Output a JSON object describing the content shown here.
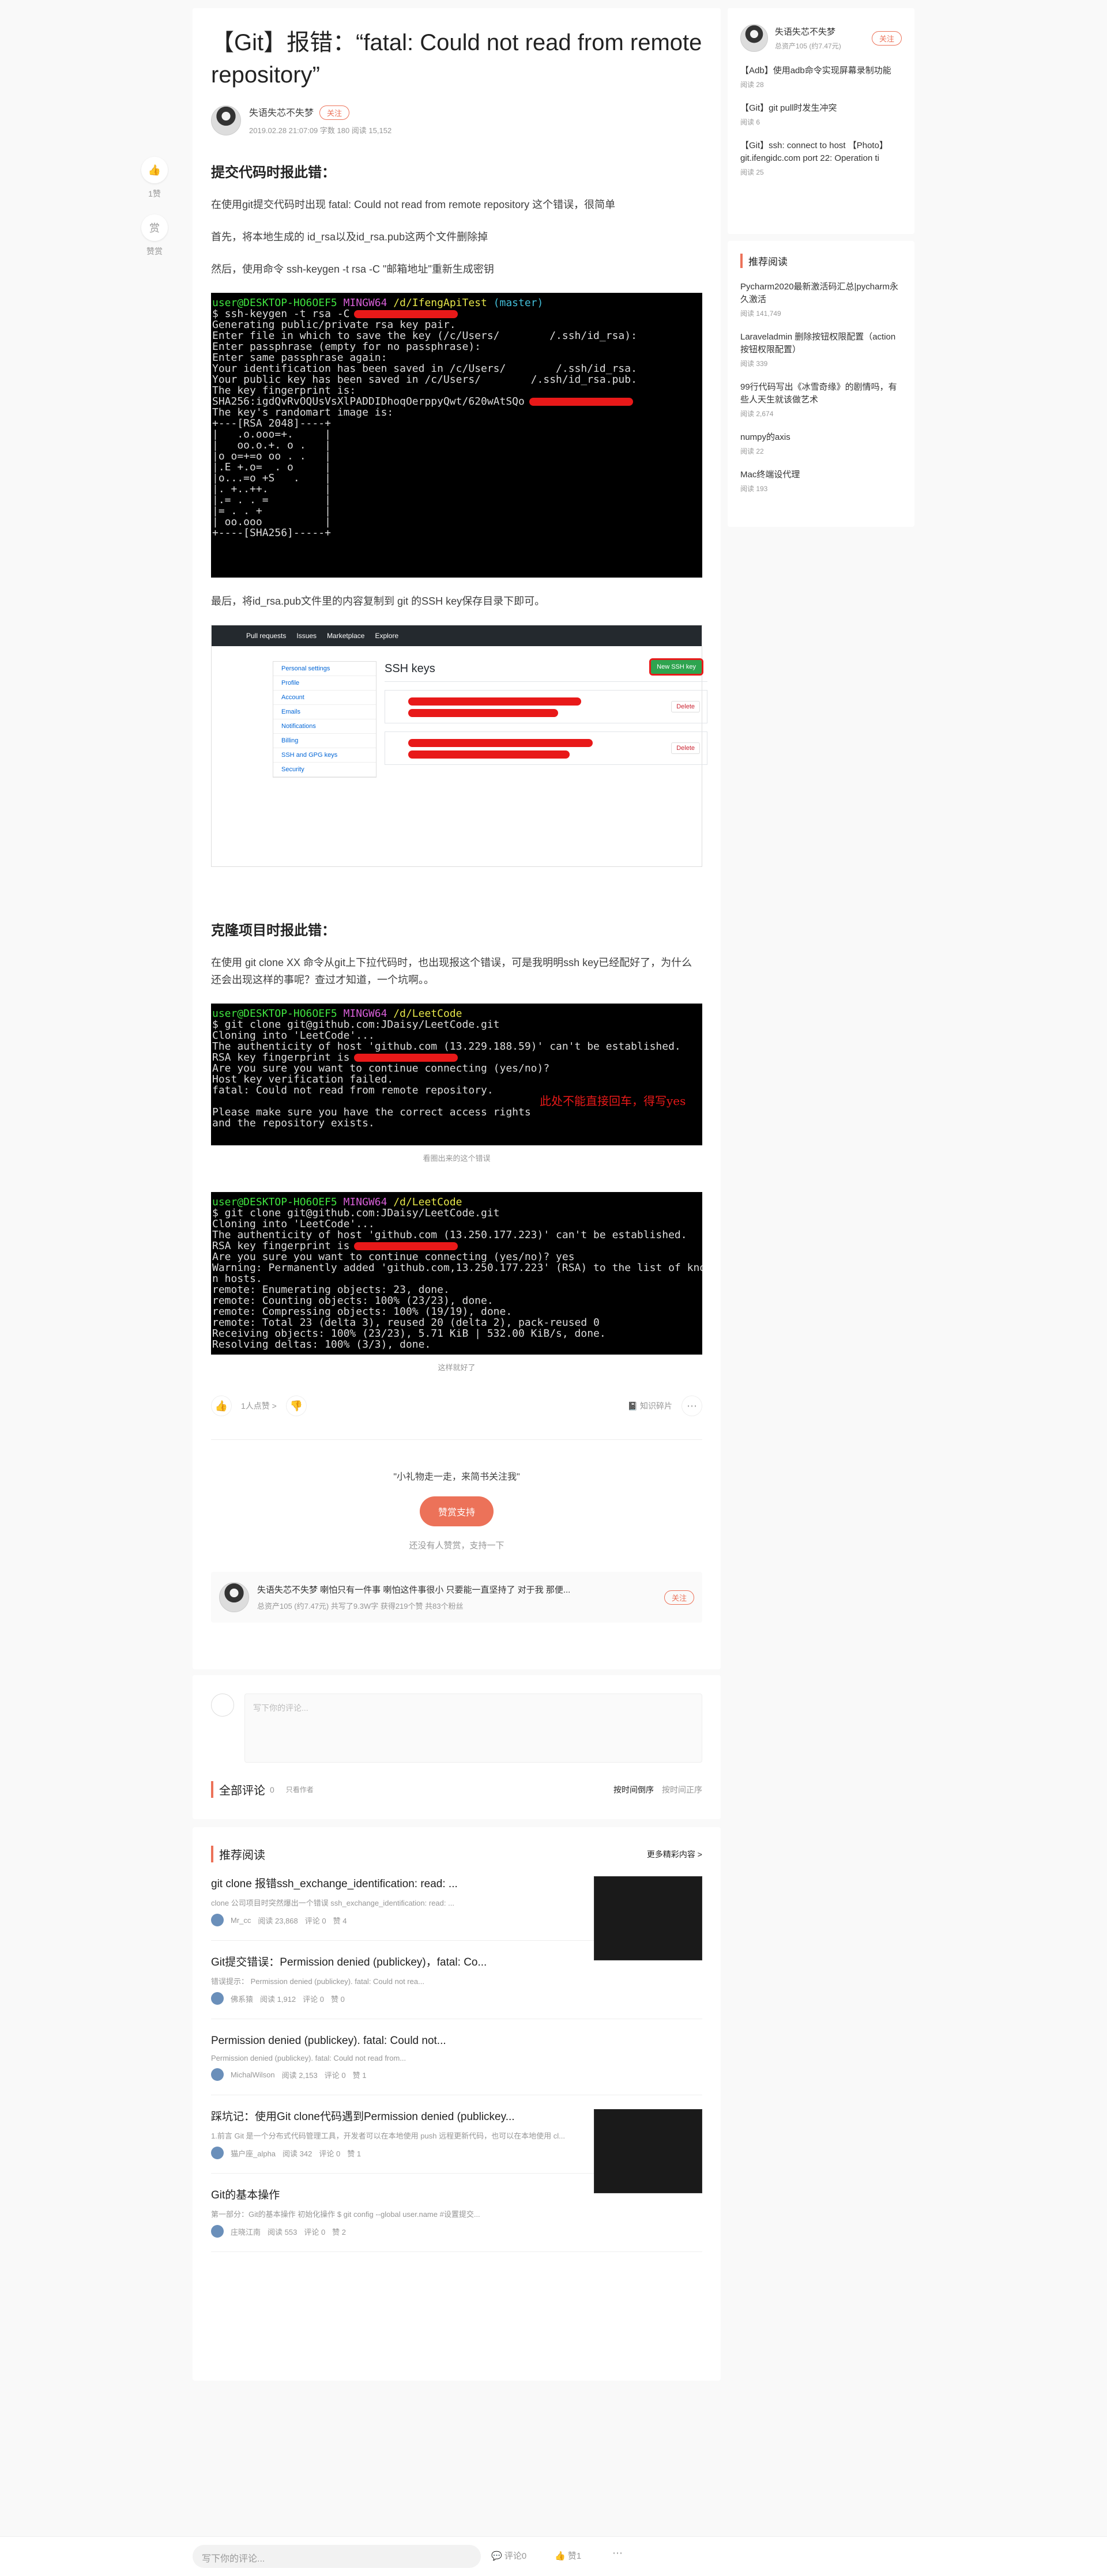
{
  "article": {
    "title": "【Git】报错：“fatal: Could not read from remote repository”",
    "author": "失语失芯不失梦",
    "follow": "关注",
    "meta": "2019.02.28 21:07:09   字数 180   阅读 15,152",
    "s1_heading": "提交代码时报此错：",
    "p1": "在使用git提交代码时出现 fatal: Could not read from remote repository 这个错误，很简单",
    "p2": "首先，将本地生成的 id_rsa以及id_rsa.pub这两个文件删除掉",
    "p3": "然后，使用命令 ssh-keygen -t rsa -C \"邮箱地址\"重新生成密钥",
    "p4": "最后，将id_rsa.pub文件里的内容复制到 git 的SSH key保存目录下即可。",
    "s2_heading": "克隆项目时报此错：",
    "p5": "在使用 git clone XX 命令从git上下拉代码时，也出现报这个错误，可是我明明ssh key已经配好了，为什么还会出现这样的事呢？查过才知道，一个坑啊。。",
    "caption1": "看圈出来的这个错误",
    "caption2": "这样就好了",
    "annotation": "此处不能直接回车，得写yes",
    "likes": "1人点赞 >",
    "collection": "知识碎片",
    "reward_note": "\"小礼物走一走，来简书关注我\"",
    "reward_button": "赞赏支持",
    "reward_empty": "还没有人赞赏，支持一下",
    "author_bio": "失语失芯不失梦  喇怕只有一件事 喇怕这件事很小 只要能一直坚持了 对于我 那便...",
    "author_stats": "总资产105 (约7.47元)   共写了9.3W字   获得219个赞   共83个粉丝"
  },
  "terminal1": [
    [
      "user@DESKTOP-HO6OEF5 ",
      "MINGW64 ",
      "/d/IfengApiTest ",
      "(master)"
    ],
    "$ ssh-keygen -t rsa -C",
    "Generating public/private rsa key pair.",
    "Enter file in which to save the key (/c/Users/        /.ssh/id_rsa):",
    "Enter passphrase (empty for no passphrase):",
    "Enter same passphrase again:",
    "Your identification has been saved in /c/Users/        /.ssh/id_rsa.",
    "Your public key has been saved in /c/Users/        /.ssh/id_rsa.pub.",
    "The key fingerprint is:",
    "SHA256:igdQvRvOQUsVsXlPADDIDhoqOerppyQwt/620wAtSQo",
    "The key's randomart image is:",
    "+---[RSA 2048]----+",
    "|   .o.ooo=+.     |",
    "|   oo.o.+. o .   |",
    "|o o=+=o oo . .   |",
    "|.E +.o=  . o     |",
    "|o...=o +S   .    |",
    "|. +..++.         |",
    "|.= . . =         |",
    "|= . . +          |",
    "| oo.ooo          |",
    "+----[SHA256]-----+"
  ],
  "terminal2": [
    [
      "user@DESKTOP-HO6OEF5 ",
      "MINGW64 ",
      "/d/LeetCode",
      ""
    ],
    "$ git clone git@github.com:JDaisy/LeetCode.git",
    "Cloning into 'LeetCode'...",
    "The authenticity of host 'github.com (13.229.188.59)' can't be established.",
    "RSA key fingerprint is",
    "Are you sure you want to continue connecting (yes/no)?",
    "Host key verification failed.",
    "fatal: Could not read from remote repository.",
    "",
    "Please make sure you have the correct access rights",
    "and the repository exists."
  ],
  "terminal3": [
    [
      "user@DESKTOP-HO6OEF5 ",
      "MINGW64 ",
      "/d/LeetCode",
      ""
    ],
    "$ git clone git@github.com:JDaisy/LeetCode.git",
    "Cloning into 'LeetCode'...",
    "The authenticity of host 'github.com (13.250.177.223)' can't be established.",
    "RSA key fingerprint is",
    "Are you sure you want to continue connecting (yes/no)? yes",
    "Warning: Permanently added 'github.com,13.250.177.223' (RSA) to the list of know",
    "n hosts.",
    "remote: Enumerating objects: 23, done.",
    "remote: Counting objects: 100% (23/23), done.",
    "remote: Compressing objects: 100% (19/19), done.",
    "remote: Total 23 (delta 3), reused 20 (delta 2), pack-reused 0",
    "Receiving objects: 100% (23/23), 5.71 KiB | 532.00 KiB/s, done.",
    "Resolving deltas: 100% (3/3), done."
  ],
  "github": {
    "nav": [
      "Pull requests",
      "Issues",
      "Marketplace",
      "Explore"
    ],
    "side": [
      "Personal settings",
      "Profile",
      "Account",
      "Emails",
      "Notifications",
      "Billing",
      "SSH and GPG keys",
      "Security"
    ],
    "title": "SSH keys",
    "new_key": "New SSH key",
    "delete": "Delete"
  },
  "left_actions": {
    "likes": "1赞",
    "reward_icon": "赏",
    "reward": "赞赏"
  },
  "comments": {
    "placeholder": "写下你的评论...",
    "all": "全部评论",
    "count": "0",
    "only_author": "只看作者",
    "sort_time": "按时间倒序",
    "sort_asc": "按时间正序"
  },
  "recommend": {
    "title": "推荐阅读",
    "more": "更多精彩内容 >",
    "items": [
      {
        "title": "git clone 报错ssh_exchange_identification: read: ...",
        "desc": "clone 公司项目时突然爆出一个错误 ssh_exchange_identification: read: ...",
        "author": "Mr_cc",
        "reads": "阅读 23,868",
        "comments": "评论 0",
        "likes": "赞 4",
        "thumb": true
      },
      {
        "title": "Git提交错误：Permission denied (publickey)，fatal: Co...",
        "desc": "错误提示：  Permission denied (publickey). fatal: Could not rea...",
        "author": "佛系猿",
        "reads": "阅读 1,912",
        "comments": "评论 0",
        "likes": "赞 0",
        "thumb": false
      },
      {
        "title": "Permission denied (publickey). fatal: Could not...",
        "desc": "Permission denied (publickey). fatal: Could not read from...",
        "author": "MichalWilson",
        "reads": "阅读 2,153",
        "comments": "评论 0",
        "likes": "赞 1",
        "thumb": false
      },
      {
        "title": "踩坑记：使用Git clone代码遇到Permission denied (publickey...",
        "desc": "1.前言 Git 是一个分布式代码管理工具，开发者可以在本地使用 push 远程更新代码，也可以在本地使用 cl...",
        "author": "猫户座_alpha",
        "reads": "阅读 342",
        "comments": "评论 0",
        "likes": "赞 1",
        "thumb": true
      },
      {
        "title": "Git的基本操作",
        "desc": "第一部分：Git的基本操作 初始化操作 $ git config --global user.name #设置提交...",
        "author": "庄晓江南",
        "reads": "阅读 553",
        "comments": "评论 0",
        "likes": "赞 2",
        "thumb": false
      }
    ]
  },
  "sidebar": {
    "author": "失语失芯不失梦",
    "author_sub": "总资产105 (约7.47元)",
    "follow": "关注",
    "author_posts": [
      {
        "title": "【Adb】使用adb命令实现屏幕录制功能",
        "reads": "阅读 28"
      },
      {
        "title": "【Git】git pull时发生冲突",
        "reads": "阅读 6"
      },
      {
        "title": "【Git】ssh: connect to host 【Photo】git.ifengidc.com port 22: Operation ti",
        "reads": "阅读 25"
      }
    ],
    "rec_title": "推荐阅读",
    "rec_posts": [
      {
        "title": "Pycharm2020最新激活码汇总|pycharm永久激活",
        "reads": "阅读 141,749"
      },
      {
        "title": "Laraveladmin 删除按钮权限配置（action 按钮权限配置）",
        "reads": "阅读 339"
      },
      {
        "title": "99行代码写出《冰雪奇缘》的剧情吗，有些人天生就该做艺术",
        "reads": "阅读 2,674"
      },
      {
        "title": "numpy的axis",
        "reads": "阅读 22"
      },
      {
        "title": "Mac终端设代理",
        "reads": "阅读 193"
      }
    ]
  },
  "bottombar": {
    "placeholder": "写下你的评论...",
    "comments": "评论0",
    "likes": "赞1"
  }
}
